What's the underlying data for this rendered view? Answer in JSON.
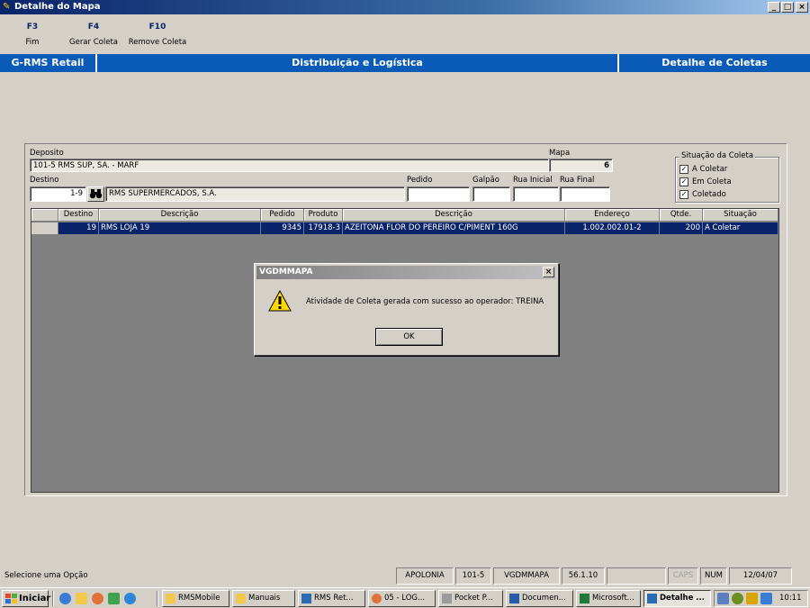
{
  "window": {
    "title": "Detalhe do Mapa",
    "controls": [
      "_",
      "□",
      "×"
    ]
  },
  "function_keys": [
    {
      "key": "F3",
      "label": "Fim"
    },
    {
      "key": "F4",
      "label": "Gerar Coleta"
    },
    {
      "key": "F10",
      "label": "Remove Coleta"
    }
  ],
  "header": {
    "app": "G-RMS Retail",
    "module": "Distribuição e Logística",
    "screen": "Detalhe de Coletas"
  },
  "form": {
    "deposito_label": "Deposito",
    "deposito_value": "101-5  RMS SUP, SA. - MARF",
    "mapa_label": "Mapa",
    "mapa_value": "6",
    "destino_label": "Destino",
    "destino_code": "1-9",
    "destino_name": "RMS SUPERMERCADOS, S.A.",
    "pedido_label": "Pedido",
    "galpao_label": "Galpão",
    "rua_inicial_label": "Rua Inicial",
    "rua_final_label": "Rua Final"
  },
  "situacao": {
    "title": "Situação da Coleta",
    "options": [
      {
        "label": "A Coletar",
        "checked": true
      },
      {
        "label": "Em Coleta",
        "checked": true
      },
      {
        "label": "Coletado",
        "checked": true
      }
    ]
  },
  "grid": {
    "columns": [
      "Destino",
      "Descrição",
      "Pedido",
      "Produto",
      "Descrição",
      "Endereço",
      "Qtde.",
      "Situação"
    ],
    "rows": [
      {
        "destino": "19",
        "descricao": "RMS LOJA 19",
        "pedido": "9345",
        "produto": "17918-3",
        "produto_desc": "AZEITONA FLOR DO PEREIRO C/PIMENT 160G",
        "endereco": "1.002.002.01-2",
        "qtde": "200",
        "situacao": "A Coletar"
      }
    ]
  },
  "dialog": {
    "title": "VGDMMAPA",
    "message": "Atividade de Coleta gerada com sucesso ao operador: TREINA",
    "ok": "OK"
  },
  "status_bar": {
    "message": "Selecione uma Opção",
    "server": "APOLONIA",
    "deposito": "101-5",
    "program": "VGDMMAPA",
    "version": "56.1.10",
    "caps": "CAPS",
    "num": "NUM",
    "date": "12/04/07"
  },
  "taskbar": {
    "start": "Iniciar",
    "buttons": [
      "RMSMobile",
      "Manuais",
      "RMS Ret...",
      "05 - LOG...",
      "Pocket P...",
      "Documen...",
      "Microsoft...",
      "Detalhe ..."
    ],
    "clock": "10:11"
  }
}
